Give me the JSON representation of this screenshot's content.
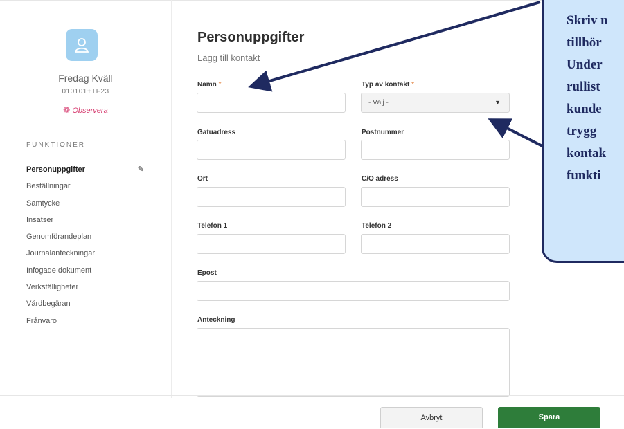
{
  "patient": {
    "name": "Fredag Kväll",
    "id": "010101+TF23",
    "observe_label": "Observera"
  },
  "sidebar": {
    "section_label": "FUNKTIONER",
    "items": [
      {
        "label": "Personuppgifter",
        "active": true
      },
      {
        "label": "Beställningar"
      },
      {
        "label": "Samtycke"
      },
      {
        "label": "Insatser"
      },
      {
        "label": "Genomförandeplan"
      },
      {
        "label": "Journalanteckningar"
      },
      {
        "label": "Infogade dokument"
      },
      {
        "label": "Verkställigheter"
      },
      {
        "label": "Vårdbegäran"
      },
      {
        "label": "Frånvaro"
      }
    ]
  },
  "form": {
    "title": "Personuppgifter",
    "subtitle": "Lägg till kontakt",
    "required_marker": "*",
    "fields": {
      "name": {
        "label": "Namn",
        "value": ""
      },
      "contact_type": {
        "label": "Typ av kontakt",
        "value": "- Välj -"
      },
      "street": {
        "label": "Gatuadress",
        "value": ""
      },
      "postal": {
        "label": "Postnummer",
        "value": ""
      },
      "city": {
        "label": "Ort",
        "value": ""
      },
      "co": {
        "label": "C/O adress",
        "value": ""
      },
      "phone1": {
        "label": "Telefon 1",
        "value": ""
      },
      "phone2": {
        "label": "Telefon 2",
        "value": ""
      },
      "email": {
        "label": "Epost",
        "value": ""
      },
      "note": {
        "label": "Anteckning",
        "value": ""
      }
    }
  },
  "footer": {
    "cancel_label": "Avbryt",
    "save_label": "Spara"
  },
  "callout": {
    "lines": [
      "Skriv n",
      "tillhör",
      "Under",
      "rullist",
      "kunde",
      "trygg",
      "kontak",
      "funkti"
    ]
  },
  "colors": {
    "accent_green": "#2e7d3a",
    "required_orange": "#e0782f",
    "observe_pink": "#d63a6e",
    "avatar_blue": "#9fd0f0",
    "callout_fill": "#cfe6fb",
    "callout_border": "#1f2a60"
  },
  "icons": {
    "avatar": "user-icon",
    "observe": "flower-icon",
    "edit": "pencil-icon",
    "select": "chevron-down-icon"
  }
}
